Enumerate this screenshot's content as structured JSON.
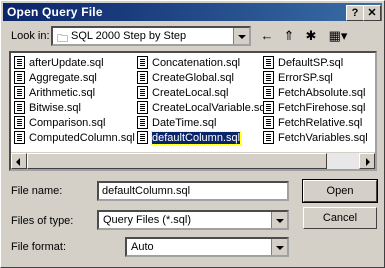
{
  "window": {
    "title": "Open Query File",
    "help_button": "?",
    "close_button": "✕"
  },
  "lookin": {
    "label": "Look in:",
    "folder": "SQL 2000 Step by Step"
  },
  "toolbar": {
    "back": "←",
    "up_folder": "⇑",
    "new_folder": "✱",
    "view_menu": "▦▾"
  },
  "files": [
    [
      "afterUpdate.sql",
      "Aggregate.sql",
      "Arithmetic.sql",
      "Bitwise.sql",
      "Comparison.sql",
      "ComputedColumn.sql"
    ],
    [
      "Concatenation.sql",
      "CreateGlobal.sql",
      "CreateLocal.sql",
      "CreateLocalVariable.sql",
      "DateTime.sql",
      "defaultColumn.sql"
    ],
    [
      "DefaultSP.sql",
      "ErrorSP.sql",
      "FetchAbsolute.sql",
      "FetchFirehose.sql",
      "FetchRelative.sql",
      "FetchVariables.sql"
    ]
  ],
  "selected_file": "defaultColumn.sql",
  "filename": {
    "label": "File name:",
    "value": "defaultColumn.sql"
  },
  "filetype": {
    "label": "Files of type:",
    "value": "Query Files (*.sql)"
  },
  "fileformat": {
    "label": "File format:",
    "value": "Auto"
  },
  "buttons": {
    "open": "Open",
    "cancel": "Cancel"
  }
}
